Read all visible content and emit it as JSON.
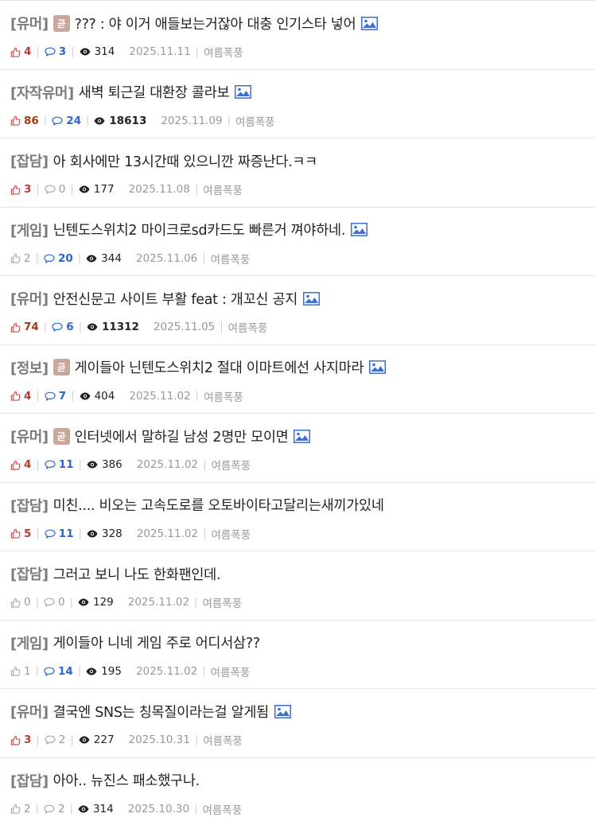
{
  "posts": [
    {
      "category": "[유머]",
      "badge": "곧",
      "title": "??? : 야 이거 애들보는거잖아 대충 인기스타 넣어",
      "has_image": true,
      "likes": "4",
      "likes_hot": true,
      "comments": "3",
      "comments_hot": true,
      "views": "314",
      "views_bold": false,
      "date": "2025.11.11",
      "author": "여름폭풍"
    },
    {
      "category": "[자작유머]",
      "badge": "",
      "title": "새벽 퇴근길 대환장 콜라보",
      "has_image": true,
      "likes": "86",
      "likes_hot": true,
      "likes_bold": true,
      "comments": "24",
      "comments_hot": true,
      "views": "18613",
      "views_bold": true,
      "date": "2025.11.09",
      "author": "여름폭풍"
    },
    {
      "category": "[잡담]",
      "badge": "",
      "title": "아 회사에만 13시간때 있으니깐 짜증난다.ㅋㅋ",
      "has_image": false,
      "likes": "3",
      "likes_hot": true,
      "comments": "0",
      "comments_hot": false,
      "views": "177",
      "views_bold": false,
      "date": "2025.11.08",
      "author": "여름폭풍"
    },
    {
      "category": "[게임]",
      "badge": "",
      "title": "닌텐도스위치2 마이크로sd카드도 빠른거 껴야하네.",
      "has_image": true,
      "likes": "2",
      "likes_hot": false,
      "comments": "20",
      "comments_hot": true,
      "views": "344",
      "views_bold": false,
      "date": "2025.11.06",
      "author": "여름폭풍"
    },
    {
      "category": "[유머]",
      "badge": "",
      "title": "안전신문고 사이트 부활 feat : 개꼬신 공지",
      "has_image": true,
      "likes": "74",
      "likes_hot": true,
      "likes_bold": true,
      "comments": "6",
      "comments_hot": true,
      "views": "11312",
      "views_bold": true,
      "date": "2025.11.05",
      "author": "여름폭풍"
    },
    {
      "category": "[정보]",
      "badge": "곧",
      "title": "게이들아 닌텐도스위치2 절대 이마트에선 사지마라",
      "has_image": true,
      "likes": "4",
      "likes_hot": true,
      "comments": "7",
      "comments_hot": true,
      "views": "404",
      "views_bold": false,
      "date": "2025.11.02",
      "author": "여름폭풍"
    },
    {
      "category": "[유머]",
      "badge": "곧",
      "title": "인터넷에서 말하길 남성 2명만 모이면",
      "has_image": true,
      "likes": "4",
      "likes_hot": true,
      "comments": "11",
      "comments_hot": true,
      "views": "386",
      "views_bold": false,
      "date": "2025.11.02",
      "author": "여름폭풍"
    },
    {
      "category": "[잡담]",
      "badge": "",
      "title": "미친.... 비오는 고속도로를 오토바이타고달리는새끼가있네",
      "has_image": false,
      "likes": "5",
      "likes_hot": true,
      "comments": "11",
      "comments_hot": true,
      "views": "328",
      "views_bold": false,
      "date": "2025.11.02",
      "author": "여름폭풍"
    },
    {
      "category": "[잡담]",
      "badge": "",
      "title": "그러고 보니 나도 한화팬인데.",
      "has_image": false,
      "likes": "0",
      "likes_hot": false,
      "comments": "0",
      "comments_hot": false,
      "views": "129",
      "views_bold": false,
      "date": "2025.11.02",
      "author": "여름폭풍"
    },
    {
      "category": "[게임]",
      "badge": "",
      "title": "게이들아 니네 게임 주로 어디서삼??",
      "has_image": false,
      "likes": "1",
      "likes_hot": false,
      "comments": "14",
      "comments_hot": true,
      "views": "195",
      "views_bold": false,
      "date": "2025.11.02",
      "author": "여름폭풍"
    },
    {
      "category": "[유머]",
      "badge": "",
      "title": "결국엔 SNS는 칭목질이라는걸 알게됨",
      "has_image": true,
      "likes": "3",
      "likes_hot": true,
      "comments": "2",
      "comments_hot": false,
      "views": "227",
      "views_bold": false,
      "date": "2025.10.31",
      "author": "여름폭풍"
    },
    {
      "category": "[잡담]",
      "badge": "",
      "title": "아아.. 뉴진스 패소했구나.",
      "has_image": false,
      "likes": "2",
      "likes_hot": false,
      "comments": "2",
      "comments_hot": false,
      "views": "314",
      "views_bold": false,
      "date": "2025.10.30",
      "author": "여름폭풍"
    }
  ],
  "colors": {
    "badge_bg": "#c9a79b",
    "like_hot": "#c94a4a",
    "comment_hot": "#2a67d1",
    "category": "#7b7b7b",
    "meta_gray": "#999999"
  },
  "icons": {
    "like": "thumbs-up-icon",
    "comment": "comment-bubble-icon",
    "views": "eye-icon",
    "image": "image-attachment-icon"
  }
}
